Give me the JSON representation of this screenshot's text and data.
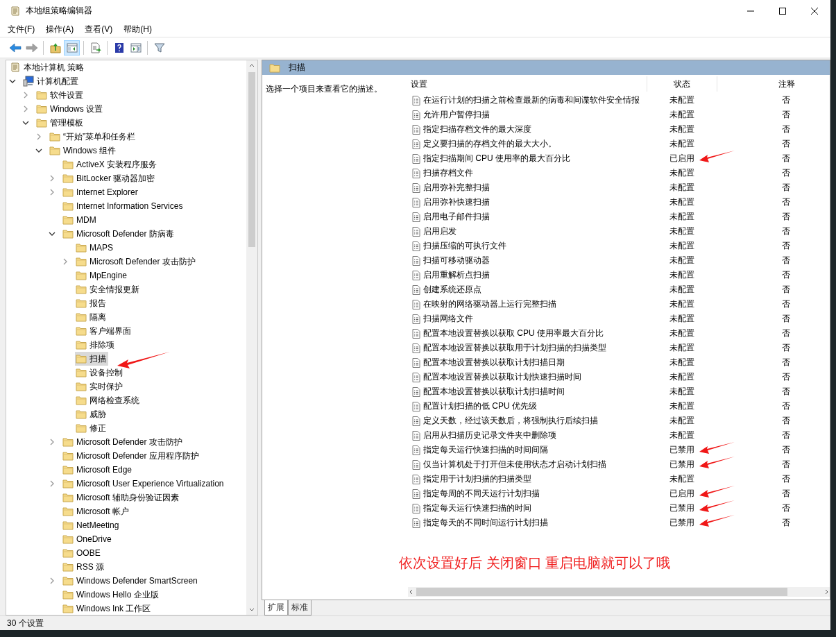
{
  "window": {
    "title": "本地组策略编辑器"
  },
  "menu": [
    "文件(F)",
    "操作(A)",
    "查看(V)",
    "帮助(H)"
  ],
  "toolbar": [
    {
      "kind": "back",
      "selected": false,
      "disabled": false
    },
    {
      "kind": "forward",
      "selected": false,
      "disabled": true
    },
    {
      "kind": "up",
      "selected": false,
      "disabled": false
    },
    {
      "kind": "tree",
      "selected": true,
      "disabled": false
    },
    {
      "kind": "export",
      "selected": false,
      "disabled": false
    },
    {
      "kind": "help",
      "selected": false,
      "disabled": false
    },
    {
      "kind": "pane",
      "selected": false,
      "disabled": false
    },
    {
      "kind": "filter",
      "selected": false,
      "disabled": false
    }
  ],
  "tree": [
    {
      "label": "本地计算机 策略",
      "kind": "policy",
      "selected": false,
      "children": [
        {
          "label": "计算机配置",
          "kind": "computer",
          "selected": false,
          "expanded": true,
          "children": [
            {
              "label": "软件设置",
              "kind": "folder",
              "selected": false,
              "expanded": false
            },
            {
              "label": "Windows 设置",
              "kind": "folder",
              "selected": false,
              "expanded": false
            },
            {
              "label": "管理模板",
              "kind": "folder",
              "selected": false,
              "expanded": true,
              "children": [
                {
                  "label": "“开始”菜单和任务栏",
                  "kind": "folder",
                  "selected": false,
                  "expanded": false
                },
                {
                  "label": "Windows 组件",
                  "kind": "folder",
                  "selected": false,
                  "expanded": true,
                  "children": [
                    {
                      "label": "ActiveX 安装程序服务",
                      "kind": "folder",
                      "selected": false
                    },
                    {
                      "label": "BitLocker 驱动器加密",
                      "kind": "folder",
                      "selected": false,
                      "expanded": false
                    },
                    {
                      "label": "Internet Explorer",
                      "kind": "folder",
                      "selected": false,
                      "expanded": false
                    },
                    {
                      "label": "Internet Information Services",
                      "kind": "folder",
                      "selected": false
                    },
                    {
                      "label": "MDM",
                      "kind": "folder",
                      "selected": false
                    },
                    {
                      "label": "Microsoft Defender 防病毒",
                      "kind": "folder",
                      "selected": false,
                      "expanded": true,
                      "children": [
                        {
                          "label": "MAPS",
                          "kind": "folder",
                          "selected": false
                        },
                        {
                          "label": "Microsoft Defender 攻击防护",
                          "kind": "folder",
                          "selected": false,
                          "expanded": false
                        },
                        {
                          "label": "MpEngine",
                          "kind": "folder",
                          "selected": false
                        },
                        {
                          "label": "安全情报更新",
                          "kind": "folder",
                          "selected": false
                        },
                        {
                          "label": "报告",
                          "kind": "folder",
                          "selected": false
                        },
                        {
                          "label": "隔离",
                          "kind": "folder",
                          "selected": false
                        },
                        {
                          "label": "客户端界面",
                          "kind": "folder",
                          "selected": false
                        },
                        {
                          "label": "排除项",
                          "kind": "folder",
                          "selected": false
                        },
                        {
                          "label": "扫描",
                          "kind": "folder",
                          "selected": true,
                          "annotated": true
                        },
                        {
                          "label": "设备控制",
                          "kind": "folder",
                          "selected": false
                        },
                        {
                          "label": "实时保护",
                          "kind": "folder",
                          "selected": false
                        },
                        {
                          "label": "网络检查系统",
                          "kind": "folder",
                          "selected": false
                        },
                        {
                          "label": "威胁",
                          "kind": "folder",
                          "selected": false
                        },
                        {
                          "label": "修正",
                          "kind": "folder",
                          "selected": false
                        }
                      ]
                    },
                    {
                      "label": "Microsoft Defender 攻击防护",
                      "kind": "folder",
                      "selected": false,
                      "expanded": false
                    },
                    {
                      "label": "Microsoft Defender 应用程序防护",
                      "kind": "folder",
                      "selected": false
                    },
                    {
                      "label": "Microsoft Edge",
                      "kind": "folder",
                      "selected": false
                    },
                    {
                      "label": "Microsoft User Experience Virtualization",
                      "kind": "folder",
                      "selected": false,
                      "expanded": false
                    },
                    {
                      "label": "Microsoft 辅助身份验证因素",
                      "kind": "folder",
                      "selected": false
                    },
                    {
                      "label": "Microsoft 帐户",
                      "kind": "folder",
                      "selected": false
                    },
                    {
                      "label": "NetMeeting",
                      "kind": "folder",
                      "selected": false
                    },
                    {
                      "label": "OneDrive",
                      "kind": "folder",
                      "selected": false
                    },
                    {
                      "label": "OOBE",
                      "kind": "folder",
                      "selected": false
                    },
                    {
                      "label": "RSS 源",
                      "kind": "folder",
                      "selected": false
                    },
                    {
                      "label": "Windows Defender SmartScreen",
                      "kind": "folder",
                      "selected": false,
                      "expanded": false
                    },
                    {
                      "label": "Windows Hello 企业版",
                      "kind": "folder",
                      "selected": false
                    },
                    {
                      "label": "Windows Ink 工作区",
                      "kind": "folder",
                      "selected": false
                    }
                  ]
                }
              ]
            }
          ]
        }
      ]
    }
  ],
  "pane": {
    "title": "扫描",
    "description": "选择一个项目来查看它的描述。",
    "columns": [
      "设置",
      "状态",
      "注释"
    ],
    "rows": [
      {
        "name": "在运行计划的扫描之前检查最新的病毒和间谍软件安全情报",
        "status": "未配置",
        "comment": "否",
        "annotated": false
      },
      {
        "name": "允许用户暂停扫描",
        "status": "未配置",
        "comment": "否",
        "annotated": false
      },
      {
        "name": "指定扫描存档文件的最大深度",
        "status": "未配置",
        "comment": "否",
        "annotated": false
      },
      {
        "name": "定义要扫描的存档文件的最大大小。",
        "status": "未配置",
        "comment": "否",
        "annotated": false
      },
      {
        "name": "指定扫描期间 CPU 使用率的最大百分比",
        "status": "已启用",
        "comment": "否",
        "annotated": true
      },
      {
        "name": "扫描存档文件",
        "status": "未配置",
        "comment": "否",
        "annotated": false
      },
      {
        "name": "启用弥补完整扫描",
        "status": "未配置",
        "comment": "否",
        "annotated": false
      },
      {
        "name": "启用弥补快速扫描",
        "status": "未配置",
        "comment": "否",
        "annotated": false
      },
      {
        "name": "启用电子邮件扫描",
        "status": "未配置",
        "comment": "否",
        "annotated": false
      },
      {
        "name": "启用启发",
        "status": "未配置",
        "comment": "否",
        "annotated": false
      },
      {
        "name": "扫描压缩的可执行文件",
        "status": "未配置",
        "comment": "否",
        "annotated": false
      },
      {
        "name": "扫描可移动驱动器",
        "status": "未配置",
        "comment": "否",
        "annotated": false
      },
      {
        "name": "启用重解析点扫描",
        "status": "未配置",
        "comment": "否",
        "annotated": false
      },
      {
        "name": "创建系统还原点",
        "status": "未配置",
        "comment": "否",
        "annotated": false
      },
      {
        "name": "在映射的网络驱动器上运行完整扫描",
        "status": "未配置",
        "comment": "否",
        "annotated": false
      },
      {
        "name": "扫描网络文件",
        "status": "未配置",
        "comment": "否",
        "annotated": false
      },
      {
        "name": "配置本地设置替换以获取 CPU 使用率最大百分比",
        "status": "未配置",
        "comment": "否",
        "annotated": false
      },
      {
        "name": "配置本地设置替换以获取用于计划扫描的扫描类型",
        "status": "未配置",
        "comment": "否",
        "annotated": false
      },
      {
        "name": "配置本地设置替换以获取计划扫描日期",
        "status": "未配置",
        "comment": "否",
        "annotated": false
      },
      {
        "name": "配置本地设置替换以获取计划快速扫描时间",
        "status": "未配置",
        "comment": "否",
        "annotated": false
      },
      {
        "name": "配置本地设置替换以获取计划扫描时间",
        "status": "未配置",
        "comment": "否",
        "annotated": false
      },
      {
        "name": "配置计划扫描的低 CPU 优先级",
        "status": "未配置",
        "comment": "否",
        "annotated": false
      },
      {
        "name": "定义天数，经过该天数后，将强制执行后续扫描",
        "status": "未配置",
        "comment": "否",
        "annotated": false
      },
      {
        "name": "启用从扫描历史记录文件夹中删除项",
        "status": "未配置",
        "comment": "否",
        "annotated": false
      },
      {
        "name": "指定每天运行快速扫描的时间间隔",
        "status": "已禁用",
        "comment": "否",
        "annotated": true
      },
      {
        "name": "仅当计算机处于打开但未使用状态才启动计划扫描",
        "status": "已禁用",
        "comment": "否",
        "annotated": true
      },
      {
        "name": "指定用于计划扫描的扫描类型",
        "status": "未配置",
        "comment": "否",
        "annotated": false
      },
      {
        "name": "指定每周的不同天运行计划扫描",
        "status": "已启用",
        "comment": "否",
        "annotated": true
      },
      {
        "name": "指定每天运行快速扫描的时间",
        "status": "已禁用",
        "comment": "否",
        "annotated": true
      },
      {
        "name": "指定每天的不同时间运行计划扫描",
        "status": "已禁用",
        "comment": "否",
        "annotated": true
      }
    ],
    "note": "依次设置好后 关闭窗口 重启电脑就可以了哦",
    "tabs": [
      {
        "label": "扩展",
        "selected": true
      },
      {
        "label": "标准",
        "selected": false
      }
    ]
  },
  "status_bar": "30 个设置"
}
